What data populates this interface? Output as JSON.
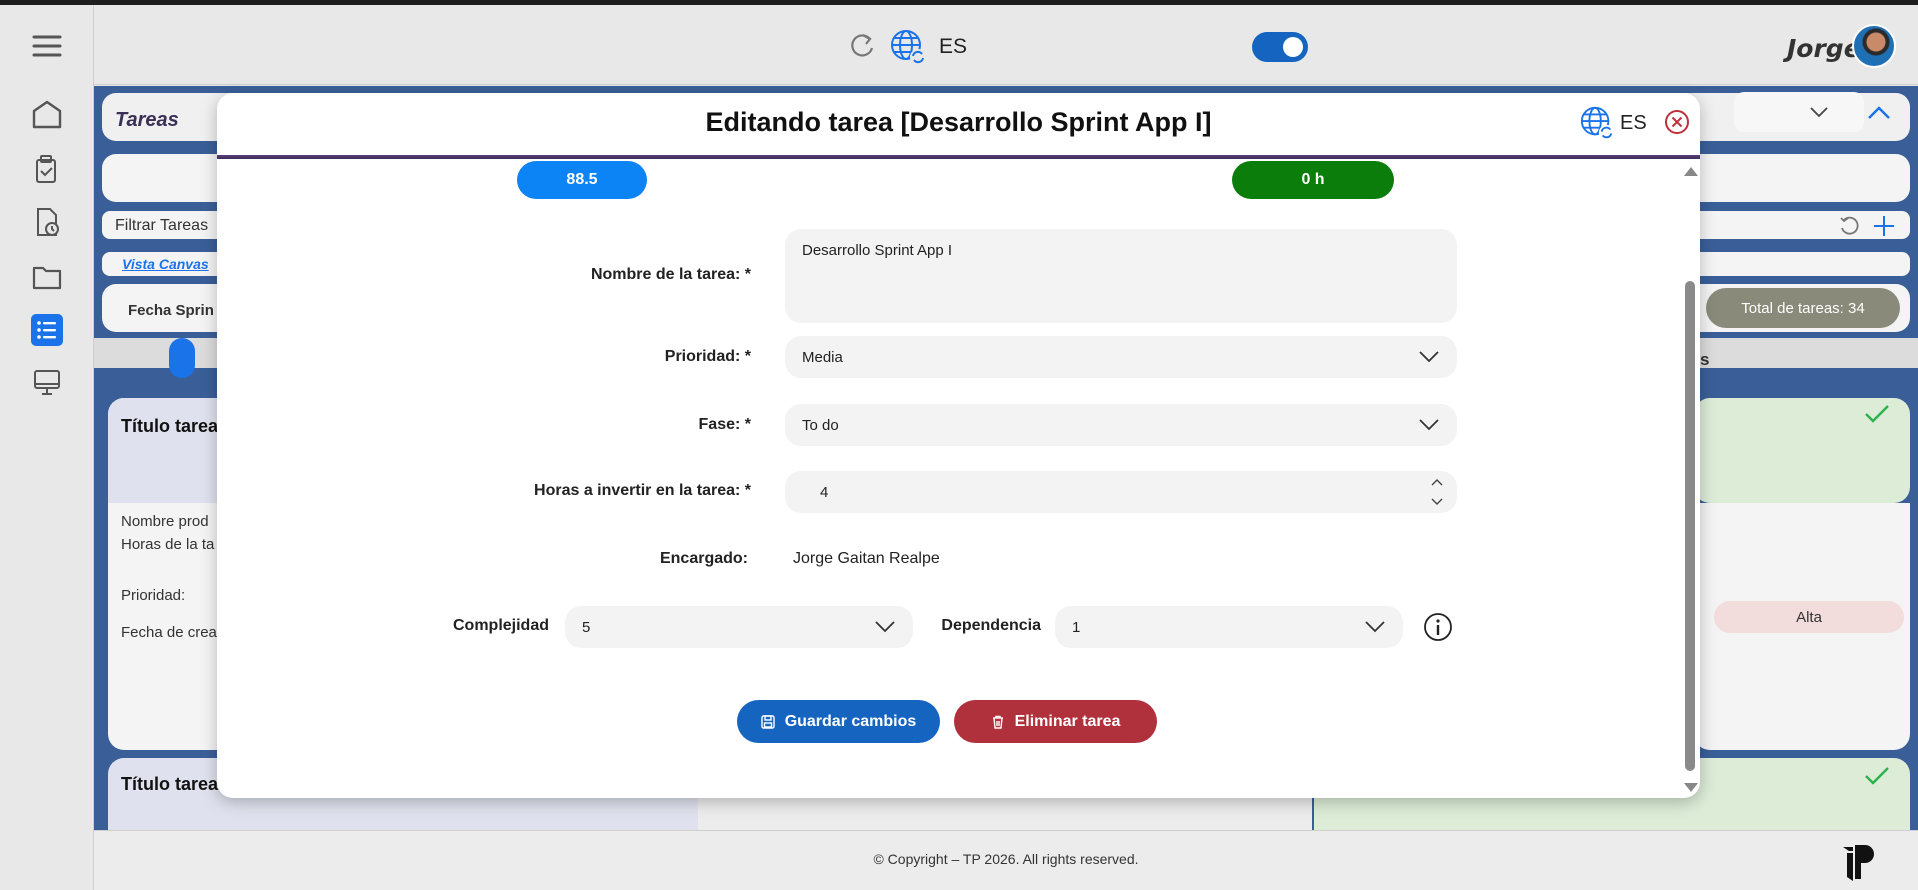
{
  "header": {
    "language": "ES",
    "user_name": "Jorge",
    "toggle_on": true
  },
  "background": {
    "section_title": "Tareas",
    "filter_label": "Filtrar Tareas",
    "canvas_link": "Vista Canvas",
    "sprint_date_label": "Fecha Sprin",
    "total_tasks": "Total de tareas: 34",
    "card_title_1": "Título tarea",
    "card_title_2": "Título tarea",
    "product_label": "Nombre prod",
    "hours_label": "Horas de la ta",
    "priority_label": "Prioridad:",
    "created_label": "Fecha de crea",
    "priority_badge": "Alta",
    "column_fragment": "s"
  },
  "modal": {
    "title": "Editando tarea [Desarrollo Sprint App I]",
    "language": "ES",
    "pill_left": "88.5",
    "pill_right": "0 h",
    "fields": {
      "name_label": "Nombre de la tarea: *",
      "name_value": "Desarrollo Sprint App I",
      "priority_label": "Prioridad: *",
      "priority_value": "Media",
      "phase_label": "Fase: *",
      "phase_value": "To do",
      "hours_label": "Horas a invertir en la tarea: *",
      "hours_value": "4",
      "owner_label": "Encargado:",
      "owner_value": "Jorge Gaitan Realpe",
      "complexity_label": "Complejidad",
      "complexity_value": "5",
      "dependency_label": "Dependencia",
      "dependency_value": "1"
    },
    "buttons": {
      "save": "Guardar cambios",
      "delete": "Eliminar tarea"
    }
  },
  "footer": {
    "copyright": "© Copyright – TP 2026. All rights reserved."
  },
  "colors": {
    "primary_blue": "#1565c0",
    "pill_blue": "#0d84f5",
    "pill_green": "#0a7d0a",
    "danger_red": "#b0313b",
    "app_bg": "#3a5f98"
  }
}
